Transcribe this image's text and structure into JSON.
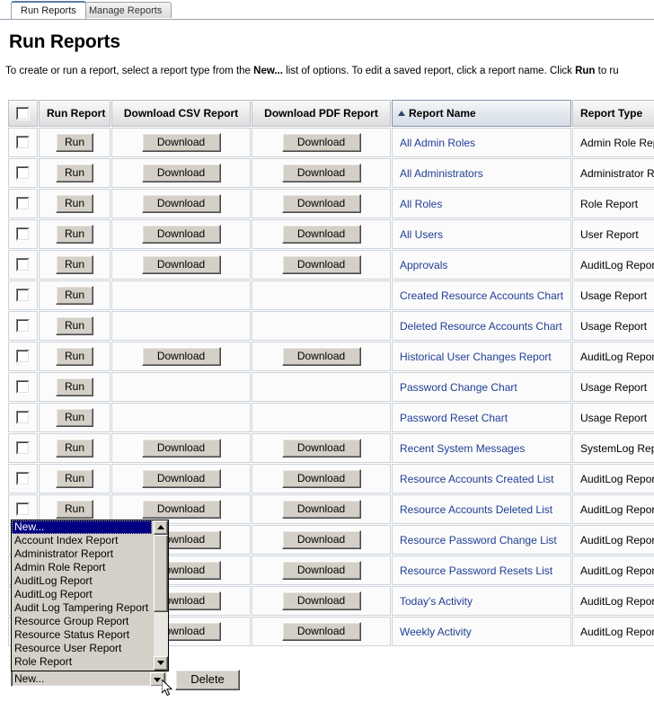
{
  "tabs": [
    {
      "label": "Run Reports",
      "active": true
    },
    {
      "label": "Manage Reports",
      "active": false
    }
  ],
  "page_title": "Run Reports",
  "intro": {
    "part1": "To create or run a report, select a report type from the ",
    "bold1": "New...",
    "part2": " list of options. To edit a saved report, click a report name. Click ",
    "bold2": "Run",
    "part3": " to ru"
  },
  "table": {
    "headers": {
      "select_all": "",
      "run_report": "Run Report",
      "download_csv": "Download CSV Report",
      "download_pdf": "Download PDF Report",
      "report_name": "Report Name",
      "report_type": "Report Type"
    },
    "sorted_column": "Report Name",
    "sort_direction": "ascending",
    "run_label": "Run",
    "download_label": "Download",
    "rows": [
      {
        "name": "All Admin Roles",
        "type": "Admin Role Report",
        "csv": true,
        "pdf": true
      },
      {
        "name": "All Administrators",
        "type": "Administrator Report",
        "csv": true,
        "pdf": true
      },
      {
        "name": "All Roles",
        "type": "Role Report",
        "csv": true,
        "pdf": true
      },
      {
        "name": "All Users",
        "type": "User Report",
        "csv": true,
        "pdf": true
      },
      {
        "name": "Approvals",
        "type": "AuditLog Report",
        "csv": true,
        "pdf": true
      },
      {
        "name": "Created Resource Accounts Chart",
        "type": "Usage Report",
        "csv": false,
        "pdf": false
      },
      {
        "name": "Deleted Resource Accounts Chart",
        "type": "Usage Report",
        "csv": false,
        "pdf": false
      },
      {
        "name": "Historical User Changes Report",
        "type": "AuditLog Report",
        "csv": true,
        "pdf": true
      },
      {
        "name": "Password Change Chart",
        "type": "Usage Report",
        "csv": false,
        "pdf": false
      },
      {
        "name": "Password Reset Chart",
        "type": "Usage Report",
        "csv": false,
        "pdf": false
      },
      {
        "name": "Recent System Messages",
        "type": "SystemLog Report",
        "csv": true,
        "pdf": true
      },
      {
        "name": "Resource Accounts Created List",
        "type": "AuditLog Report",
        "csv": true,
        "pdf": true
      },
      {
        "name": "Resource Accounts Deleted List",
        "type": "AuditLog Report",
        "csv": true,
        "pdf": true
      },
      {
        "name": "Resource Password Change List",
        "type": "AuditLog Report",
        "csv": true,
        "pdf": true
      },
      {
        "name": "Resource Password Resets List",
        "type": "AuditLog Report",
        "csv": true,
        "pdf": true
      },
      {
        "name": "Today's Activity",
        "type": "AuditLog Report",
        "csv": true,
        "pdf": true
      },
      {
        "name": "Weekly Activity",
        "type": "AuditLog Report",
        "csv": true,
        "pdf": true
      }
    ]
  },
  "new_dropdown": {
    "selected_value": "New...",
    "open": true,
    "options": [
      "New...",
      "Account Index Report",
      "Administrator Report",
      "Admin Role Report",
      "AuditLog Report",
      "AuditLog Report",
      "Audit Log Tampering Report",
      "Resource Group Report",
      "Resource Status Report",
      "Resource User Report",
      "Role Report"
    ]
  },
  "delete_button_label": "Delete",
  "colors": {
    "link": "#1f3e94",
    "selection": "#000080",
    "button_face": "#d4d0c8",
    "sorted_header": "#e2e7ee"
  }
}
